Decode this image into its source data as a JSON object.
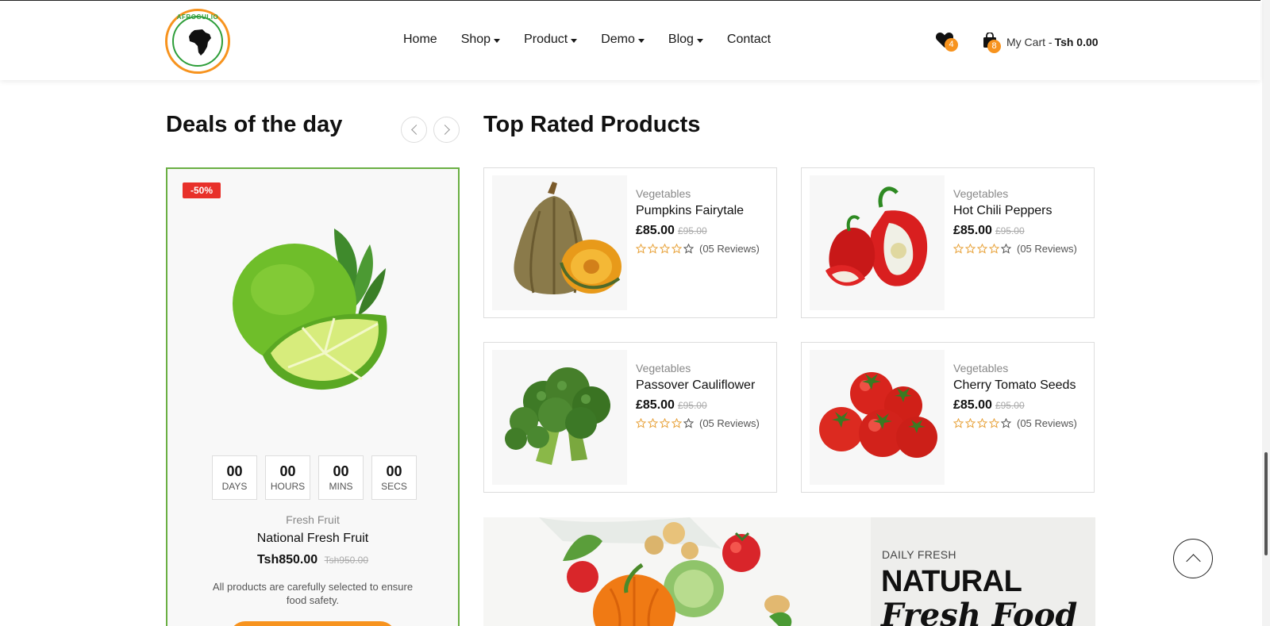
{
  "brand": {
    "name": "AFROGULIO"
  },
  "nav": {
    "items": [
      {
        "label": "Home",
        "dropdown": false
      },
      {
        "label": "Shop",
        "dropdown": true
      },
      {
        "label": "Product",
        "dropdown": true
      },
      {
        "label": "Demo",
        "dropdown": true
      },
      {
        "label": "Blog",
        "dropdown": true
      },
      {
        "label": "Contact",
        "dropdown": false
      }
    ]
  },
  "header_actions": {
    "wishlist_icon": "heart-icon",
    "wishlist_count": "4",
    "cart_icon": "shopping-bag-icon",
    "cart_count": "8",
    "cart_label": "My Cart -",
    "cart_total": "Tsh 0.00"
  },
  "deals": {
    "title": "Deals of the day",
    "discount_badge": "-50%",
    "countdown": [
      {
        "value": "00",
        "unit": "DAYS"
      },
      {
        "value": "00",
        "unit": "HOURS"
      },
      {
        "value": "00",
        "unit": "MINS"
      },
      {
        "value": "00",
        "unit": "SECS"
      }
    ],
    "product": {
      "category": "Fresh Fruit",
      "name": "National Fresh Fruit",
      "price": "Tsh850.00",
      "old_price": "Tsh950.00",
      "description": "All products are carefully selected to ensure food safety."
    }
  },
  "top_rated": {
    "title": "Top Rated Products",
    "products": [
      {
        "category": "Vegetables",
        "name": "Pumpkins Fairytale",
        "price": "£85.00",
        "old_price": "£95.00",
        "rating": 4,
        "reviews": "(05 Reviews)",
        "image": "pumpkin"
      },
      {
        "category": "Vegetables",
        "name": "Hot Chili Peppers",
        "price": "£85.00",
        "old_price": "£95.00",
        "rating": 4,
        "reviews": "(05 Reviews)",
        "image": "pepper"
      },
      {
        "category": "Vegetables",
        "name": "Passover Cauliflower",
        "price": "£85.00",
        "old_price": "£95.00",
        "rating": 4,
        "reviews": "(05 Reviews)",
        "image": "broccoli"
      },
      {
        "category": "Vegetables",
        "name": "Cherry Tomato Seeds",
        "price": "£85.00",
        "old_price": "£95.00",
        "rating": 4,
        "reviews": "(05 Reviews)",
        "image": "tomato"
      }
    ]
  },
  "banner": {
    "subtitle": "DAILY FRESH",
    "title": "NATURAL",
    "title_italic": "Fresh Food"
  },
  "colors": {
    "accent_orange": "#f7931e",
    "deal_border_green": "#6aaf43",
    "sale_red": "#e8302a",
    "star_orange": "#e8a33c"
  }
}
